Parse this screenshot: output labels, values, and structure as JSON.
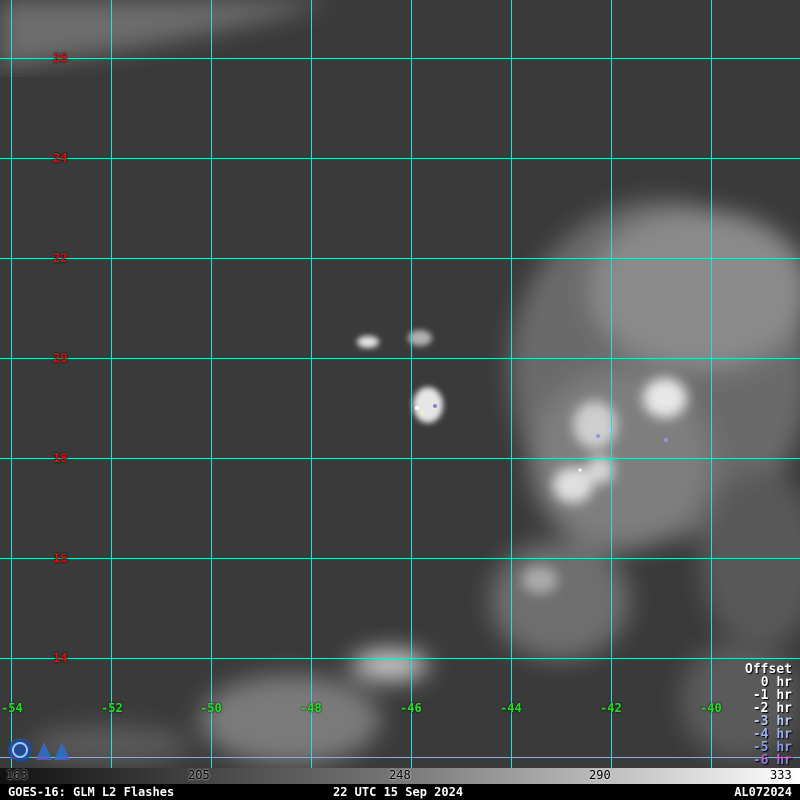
{
  "map": {
    "lat_labels": [
      "26",
      "24",
      "22",
      "20",
      "18",
      "16",
      "14"
    ],
    "lon_labels": [
      "-54",
      "-52",
      "-50",
      "-48",
      "-46",
      "-44",
      "-42",
      "-40"
    ]
  },
  "legend": {
    "title": "Offset",
    "items": [
      {
        "label": "0 hr",
        "color": "#ffffff"
      },
      {
        "label": "-1 hr",
        "color": "#ffffff"
      },
      {
        "label": "-2 hr",
        "color": "#ffffff"
      },
      {
        "label": "-3 hr",
        "color": "#b8c8f0"
      },
      {
        "label": "-4 hr",
        "color": "#9ab0ee"
      },
      {
        "label": "-5 hr",
        "color": "#8c9ae8"
      },
      {
        "label": "-6 hr",
        "color": "#9a7ad8"
      }
    ]
  },
  "colorbar": {
    "ticks": [
      "163",
      "205",
      "248",
      "290",
      "333"
    ]
  },
  "footer": {
    "left": "GOES-16: GLM L2 Flashes",
    "center": "22 UTC 15 Sep 2024",
    "right": "AL072024"
  },
  "colors": {
    "grid": "#22e0e0",
    "lat_label": "#e01010",
    "lon_label": "#22e022"
  }
}
